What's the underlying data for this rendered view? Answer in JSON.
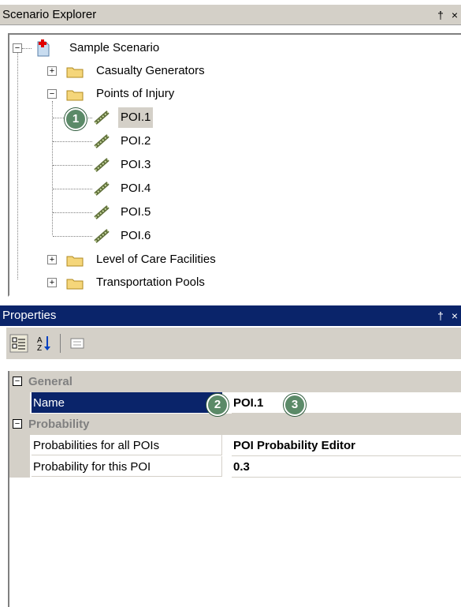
{
  "explorer": {
    "title": "Scenario Explorer",
    "pin_glyph": "†",
    "close_glyph": "×",
    "root": "Sample Scenario",
    "folders": {
      "casualty_generators": "Casualty Generators",
      "points_of_injury": "Points of Injury",
      "level_of_care": "Level of Care Facilities",
      "transportation_pools": "Transportation Pools"
    },
    "pois": [
      "POI.1",
      "POI.2",
      "POI.3",
      "POI.4",
      "POI.5",
      "POI.6"
    ],
    "selected": "POI.1"
  },
  "properties": {
    "title": "Properties",
    "pin_glyph": "†",
    "close_glyph": "×",
    "categories": {
      "general": "General",
      "probability": "Probability"
    },
    "rows": {
      "name": {
        "label": "Name",
        "value": "POI.1"
      },
      "prob_all": {
        "label": "Probabilities for all POIs",
        "value": "POI Probability Editor"
      },
      "prob_this": {
        "label": "Probability for this POI",
        "value": "0.3"
      }
    }
  },
  "callouts": [
    "1",
    "2",
    "3"
  ],
  "colors": {
    "selection": "#0a246a",
    "callout": "#5b8a68",
    "panel": "#d4d0c8"
  }
}
